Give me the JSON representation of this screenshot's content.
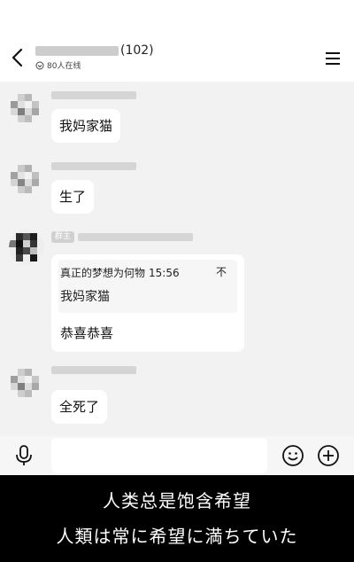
{
  "header": {
    "member_count": "(102)",
    "online_text": "80人在线"
  },
  "messages": [
    {
      "text": "我妈家猫"
    },
    {
      "text": "生了"
    },
    {
      "owner_tag": "群主",
      "quote_sender": "真正的梦想为何物",
      "quote_time": "15:56",
      "quote_close": "不",
      "quote_text": "我妈家猫",
      "reply": "恭喜恭喜"
    },
    {
      "text": "全死了"
    }
  ],
  "subtitles": {
    "line1": "人类总是饱含希望",
    "line2": "人類は常に希望に満ちていた"
  },
  "icons": [
    "back-arrow-icon",
    "menu-icon",
    "online-status-icon",
    "microphone-icon",
    "emoji-icon",
    "plus-circle-icon"
  ]
}
